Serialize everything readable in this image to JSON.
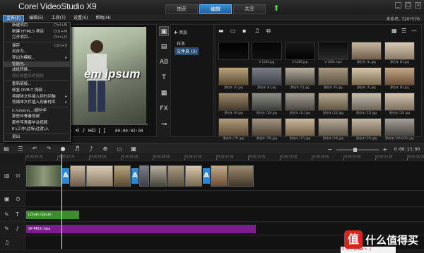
{
  "app": {
    "title": "Corel VideoStudio X9",
    "window_controls": [
      "_",
      "□",
      "×"
    ]
  },
  "steps": [
    {
      "label": "捕获",
      "active": false
    },
    {
      "label": "编辑",
      "active": true
    },
    {
      "label": "共享",
      "active": false
    }
  ],
  "menubar": {
    "items": [
      "文件(F)",
      "编辑(E)",
      "工具(T)",
      "设置(S)",
      "帮助(H)"
    ],
    "project_info": "未命名, 720*576"
  },
  "file_menu": {
    "items": [
      {
        "label": "新建项目",
        "shortcut": "Ctrl+N"
      },
      {
        "label": "新建 HTML5 项目",
        "shortcut": "Ctrl+M"
      },
      {
        "label": "打开项目...",
        "shortcut": "Ctrl+O"
      },
      {
        "label": "保存",
        "shortcut": "Ctrl+S"
      },
      {
        "label": "另存为...",
        "shortcut": ""
      },
      {
        "label": "导出为模板...",
        "shortcut": "",
        "submenu": true
      },
      {
        "label": "智能包...",
        "shortcut": "",
        "highlight": true
      },
      {
        "label": "成批转换...",
        "shortcut": ""
      },
      {
        "label": "保存修整后的视频",
        "shortcut": "",
        "disabled": true
      },
      {
        "label": "重新链接...",
        "shortcut": ""
      },
      {
        "label": "修复 DVB-T 视频...",
        "shortcut": ""
      },
      {
        "label": "将媒体文件插入到时间轴",
        "shortcut": "",
        "submenu": true
      },
      {
        "label": "将媒体文件插入到素材库",
        "shortcut": "",
        "submenu": true
      },
      {
        "label": "C:\\Users\\...\\那些年",
        "shortcut": ""
      },
      {
        "label": "那些年青春视频",
        "shortcut": ""
      },
      {
        "label": "那些年青春毕业视频",
        "shortcut": ""
      },
      {
        "label": "E:\\工作\\过场\\过渡\\入",
        "shortcut": ""
      },
      {
        "label": "退出",
        "shortcut": ""
      }
    ]
  },
  "preview": {
    "overlay_text": "em ipsum",
    "timecode": "00:00:02:00",
    "hd_label": "HD",
    "controls": [
      "▶",
      "◀◀",
      "◀",
      "▶",
      "▶▶",
      "⟲",
      "🔊"
    ]
  },
  "library": {
    "tools": [
      "media-icon",
      "instant-project-icon",
      "transition-icon",
      "title-icon",
      "graphic-icon",
      "filter-icon",
      "path-icon"
    ],
    "add_label": "添加",
    "tree": [
      {
        "label": "样本",
        "selected": false
      },
      {
        "label": "文件夹 (3)",
        "selected": true
      }
    ],
    "thumbnails": [
      {
        "caption": "",
        "color1": "#000000",
        "color2": "#101010"
      },
      {
        "caption": "V 1280.jpg",
        "color1": "#050505",
        "color2": "#111111"
      },
      {
        "caption": "V 1280.jpg",
        "color1": "#1a1a1a",
        "color2": "#000000"
      },
      {
        "caption": "V 1280.mp3",
        "color1": "#0a0a0a",
        "color2": "#2a2a2a"
      },
      {
        "caption": "那些年 (1).jpg",
        "color1": "#c9b8a1",
        "color2": "#6e5c48"
      },
      {
        "caption": "那些年 (2).jpg",
        "color1": "#d8cbb5",
        "color2": "#8a7a63"
      },
      {
        "caption": "那些年 (3).jpg",
        "color1": "#b8a57f",
        "color2": "#5a4a30"
      },
      {
        "caption": "那些年 (4).jpg",
        "color1": "#7b7f88",
        "color2": "#3c3f45"
      },
      {
        "caption": "那些年 (5).jpg",
        "color1": "#b7b0a0",
        "color2": "#4a463e"
      },
      {
        "caption": "那些年 (6).jpg",
        "color1": "#a89a82",
        "color2": "#5a5040"
      },
      {
        "caption": "那些年 (7).jpg",
        "color1": "#d6c7ad",
        "color2": "#7a6a50"
      },
      {
        "caption": "那些年 (8).jpg",
        "color1": "#c4a888",
        "color2": "#6a5038"
      },
      {
        "caption": "那些年 (9).jpg",
        "color1": "#9c8a6d",
        "color2": "#45382a"
      },
      {
        "caption": "那些年 (10).jpg",
        "color1": "#8d8f86",
        "color2": "#3b3d38"
      },
      {
        "caption": "那些年 (11).jpg",
        "color1": "#a6a096",
        "color2": "#4a463f"
      },
      {
        "caption": "那些年 (12).jpg",
        "color1": "#b9ab92",
        "color2": "#5f5440"
      },
      {
        "caption": "那些年 (13).jpg",
        "color1": "#c7bfb0",
        "color2": "#6a6255"
      },
      {
        "caption": "那些年 (14).jpg",
        "color1": "#d3c6b3",
        "color2": "#7d6e5c"
      },
      {
        "caption": "那些年 (15).jpg",
        "color1": "#b49c7c",
        "color2": "#5c4a36"
      },
      {
        "caption": "那些年 (16).jpg",
        "color1": "#a49582",
        "color2": "#4c4033"
      },
      {
        "caption": "那些年 (17).jpg",
        "color1": "#cbb99e",
        "color2": "#705e46"
      },
      {
        "caption": "那些年 (18).jpg",
        "color1": "#b8ac98",
        "color2": "#5e5446"
      },
      {
        "caption": "那些年 (19).jpg",
        "color1": "#c6b9a4",
        "color2": "#6b5e4c"
      },
      {
        "caption": "那些年(1434220).jpg",
        "color1": "#a8a09a",
        "color2": "#4a4540"
      }
    ]
  },
  "timeline": {
    "timecode": "0:00:13:00",
    "ruler_ticks": [
      "00:00:00:00",
      "00:00:02:00",
      "00:00:04:00",
      "00:00:06:00",
      "00:00:08:00",
      "00:00:10:00",
      "00:00:12:00",
      "00:00:14:00",
      "00:00:16:00",
      "00:00:18:00",
      "00:00:20:00",
      "00:00:22:00",
      "00:00:24:00"
    ],
    "title_clip": "Lorem ipsum",
    "music_clip": "SP-M03.mpa",
    "colors": {
      "title": "#3a8f2a",
      "music": "#7d1c8c",
      "accent": "#2d86d1"
    }
  },
  "watermark": {
    "logo": "值",
    "text": "什么值得买"
  },
  "ime_bar": "S 中 ·, ☺ ⌨ ✎ ♫"
}
